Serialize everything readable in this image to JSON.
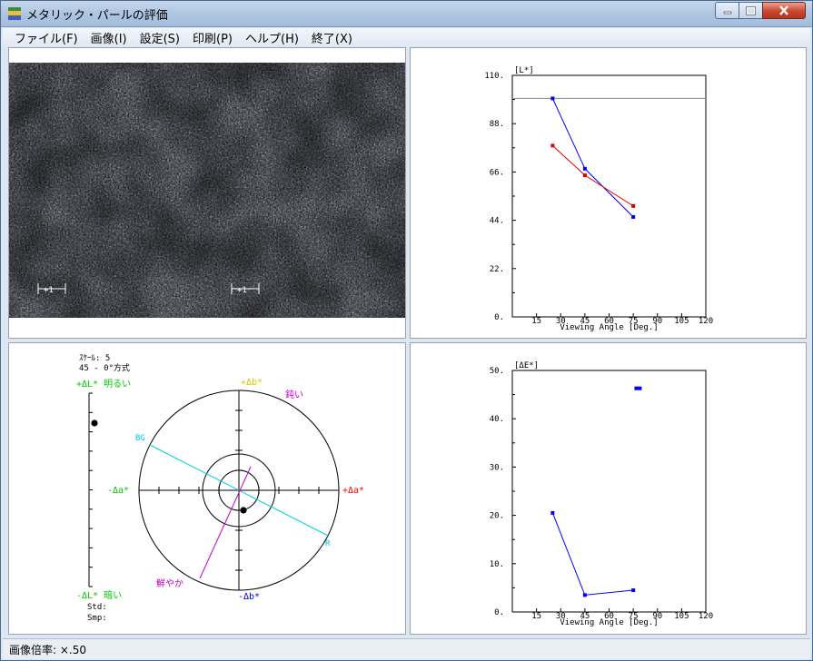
{
  "window": {
    "title": "メタリック・パールの評価"
  },
  "menu": [
    {
      "label": "ファイル(F)"
    },
    {
      "label": "画像(I)"
    },
    {
      "label": "設定(S)"
    },
    {
      "label": "印刷(P)"
    },
    {
      "label": "ヘルプ(H)"
    },
    {
      "label": "終了(X)"
    }
  ],
  "image_panel": {
    "scale_marker_left": "+1",
    "scale_marker_right": "+1"
  },
  "polar": {
    "scale_text": "ｽｹｰﾙ: 5",
    "method_text": "45 - 0°方式",
    "plus_dl": "+ΔL* 明るい",
    "minus_dl": "-ΔL* 暗い",
    "plus_db": "+Δb*",
    "minus_db": "-Δb*",
    "plus_da": "+Δa*",
    "minus_da": "-Δa*",
    "dull": "鈍い",
    "vivid": "鮮やか",
    "bg": "BG",
    "r": "R",
    "std": "Std:",
    "smp": "Smp:",
    "colors": {
      "green": "#00c800",
      "yellow": "#d8c800",
      "red": "#ff0000",
      "blue": "#0000ff",
      "magenta": "#c800c8",
      "cyan": "#00c8dc"
    }
  },
  "status": {
    "text": "画像倍率: ×.50"
  },
  "chart_data": [
    {
      "type": "line",
      "ylabel": "[L*]",
      "xlabel": "Viewing Angle [Deg.]",
      "xlim": [
        0,
        120
      ],
      "ylim": [
        0,
        110
      ],
      "xticks": [
        15,
        30,
        45,
        60,
        75,
        90,
        105,
        120
      ],
      "yticks": [
        0,
        22,
        44,
        66,
        88,
        110
      ],
      "ytick_labels": [
        "0.",
        "22.",
        "44.",
        "66.",
        "88.",
        "110."
      ],
      "reference_line": 99.5,
      "series": [
        {
          "color": "#0000ff",
          "x": [
            25,
            45,
            75
          ],
          "y": [
            99.5,
            67.5,
            45.5
          ]
        },
        {
          "color": "#e00000",
          "x": [
            25,
            45,
            75
          ],
          "y": [
            78,
            64.5,
            50.5
          ]
        }
      ]
    },
    {
      "type": "line",
      "ylabel": "[ΔE*]",
      "xlabel": "Viewing Angle [Deg.]",
      "xlim": [
        0,
        120
      ],
      "ylim": [
        0,
        50
      ],
      "xticks": [
        15,
        30,
        45,
        60,
        75,
        90,
        105,
        120
      ],
      "yticks": [
        0,
        10,
        20,
        30,
        40,
        50
      ],
      "ytick_labels": [
        "0.",
        "10.",
        "20.",
        "30.",
        "40.",
        "50."
      ],
      "series": [
        {
          "color": "#0000ff",
          "x": [
            25,
            45,
            75
          ],
          "y": [
            20.5,
            3.5,
            4.5
          ]
        }
      ],
      "extra_point": {
        "x": 78,
        "y": 46.3,
        "color": "#0000ff"
      }
    }
  ]
}
